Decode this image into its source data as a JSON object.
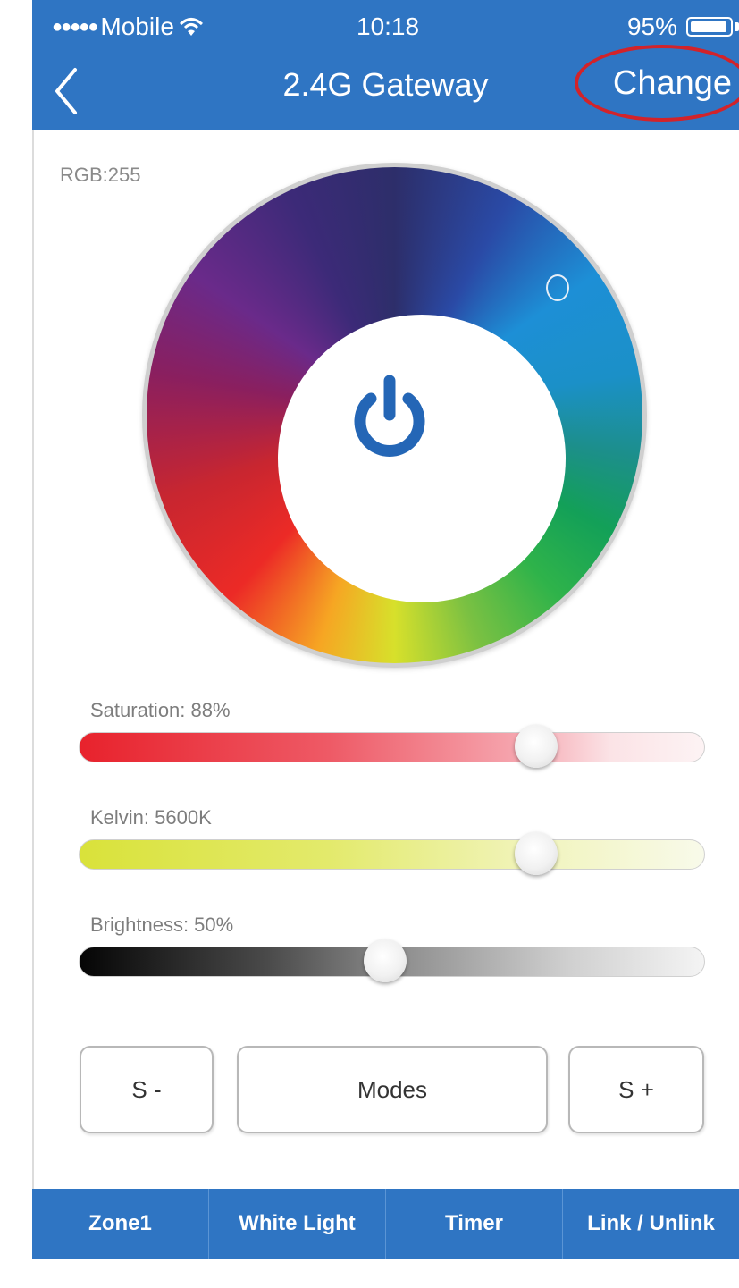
{
  "status_bar": {
    "signal_dots": "●●●●●",
    "carrier": "Mobile",
    "time": "10:18",
    "battery": "95%",
    "battery_level": 0.95
  },
  "header": {
    "title": "2.4G Gateway",
    "change_label": "Change"
  },
  "color_wheel": {
    "rgb_label": "RGB:255"
  },
  "sliders": [
    {
      "label": "Saturation: 88%",
      "value": 0.73
    },
    {
      "label": "Kelvin: 5600K",
      "value": 0.73
    },
    {
      "label": "Brightness: 50%",
      "value": 0.49
    }
  ],
  "buttons": {
    "speed_down": "S -",
    "modes": "Modes",
    "speed_up": "S +"
  },
  "tabs": [
    "Zone1",
    "White Light",
    "Timer",
    "Link / Unlink"
  ],
  "colors": {
    "brand": "#2f75c3",
    "highlight": "#d2232a"
  }
}
